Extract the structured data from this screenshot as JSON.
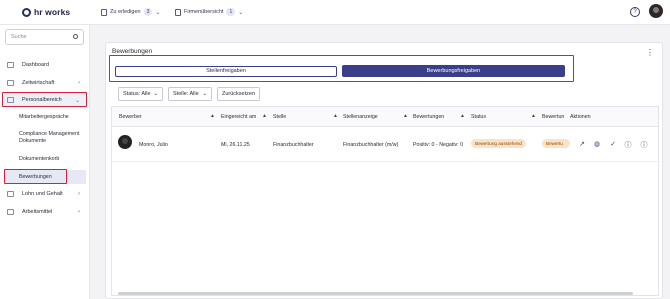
{
  "app": {
    "logo_text": "hr works"
  },
  "topbar": {
    "todo_label": "Zu erledigen",
    "todo_count": "3",
    "company_label": "Firmenübersicht",
    "company_count": "1",
    "help_glyph": "?"
  },
  "sidebar": {
    "search_placeholder": "Suche",
    "items": [
      {
        "label": "Dashboard"
      },
      {
        "label": "Zeitwirtschaft"
      },
      {
        "label": "Personalbereich"
      },
      {
        "label": "Lohn und Gehalt"
      },
      {
        "label": "Arbeitsmittel"
      }
    ],
    "subitems": [
      {
        "label": "Mitarbeitergespräche"
      },
      {
        "label": "Compliance Management"
      },
      {
        "label": "Dokumente"
      },
      {
        "label": "Dokumentenkorb"
      },
      {
        "label": "Bewerbungen"
      }
    ]
  },
  "main": {
    "title": "Bewerbungen",
    "btn_stellen": "Stellenfreigaben",
    "btn_bewerbung": "Bewerbungsfreigaben",
    "filter_status": "Status: Alle",
    "filter_stelle": "Stelle: Alle",
    "reset": "Zurücksetzen",
    "columns": [
      "Bewerber",
      "Eingereicht am",
      "Stelle",
      "Stellenanzeige",
      "Bewertungen",
      "Status",
      "Bewertun",
      "Aktionen"
    ],
    "rows": [
      {
        "name": "Monro, Julio",
        "date": "Mi, 26.11.25",
        "stelle": "Finanzbuchhalter",
        "anzeige": "Finanzbuchhalter (m/w)",
        "bewertungen": "Positiv: 0 - Negativ: 0",
        "status": "Bewertung ausstehend",
        "bewertung_badge": "Bewertu"
      }
    ]
  },
  "colors": {
    "accent": "#3b3f8a",
    "highlight": "#d3213c",
    "pill": "#fbe2c5"
  }
}
